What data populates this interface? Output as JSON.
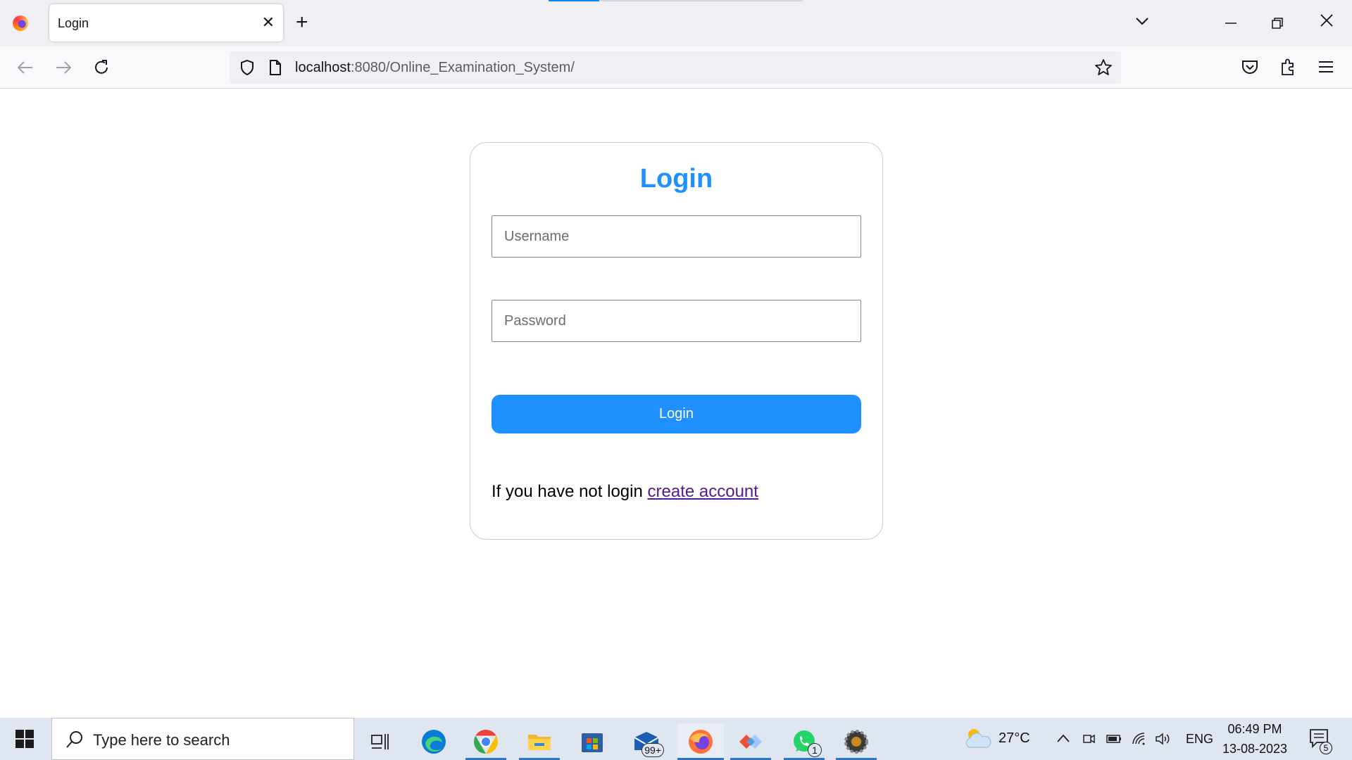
{
  "browser": {
    "tab_title": "Login",
    "url_host": "localhost",
    "url_path": ":8080/Online_Examination_System/"
  },
  "login": {
    "title": "Login",
    "username_placeholder": "Username",
    "password_placeholder": "Password",
    "submit_label": "Login",
    "signup_prompt": "If you have not login",
    "signup_link": "create account"
  },
  "taskbar": {
    "search_placeholder": "Type here to search",
    "mail_badge": "99+",
    "whatsapp_badge": "1",
    "temperature": "27°C",
    "language": "ENG",
    "time": "06:49 PM",
    "date": "13-08-2023",
    "notification_count": "5"
  },
  "colors": {
    "accent": "#1e90ff",
    "link_visited": "#551a8b"
  }
}
